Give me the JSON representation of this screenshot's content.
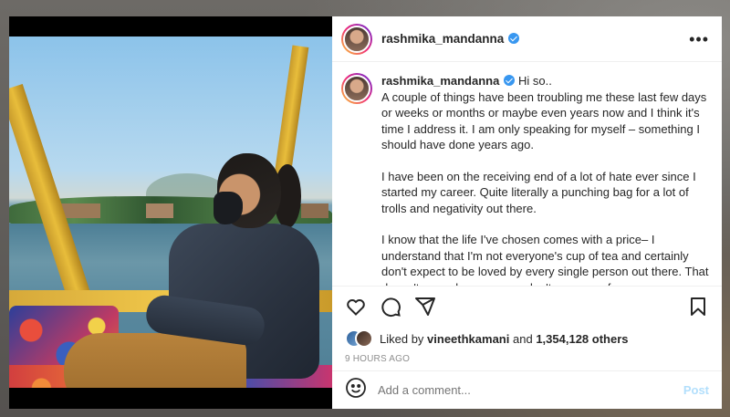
{
  "header": {
    "username": "rashmika_mandanna",
    "more_label": "•••"
  },
  "caption": {
    "username": "rashmika_mandanna",
    "greeting": "Hi so..",
    "paragraphs": [
      "A couple of things have been troubling me these last few days or weeks or months or maybe even years now and I think it's time I address it. I am only speaking for myself – something I should have done years ago.",
      "I have been on the receiving end of a lot of hate ever since I started my career. Quite literally a punching bag for a lot of trolls and negativity out there.",
      "I know that the life I've chosen comes with a price– I understand that I'm not everyone's cup of tea and certainly don't expect to be loved by every single person out there. That doesn't mean because you don't approve of me you can spew negativity"
    ]
  },
  "likes": {
    "prefix": "Liked by",
    "user": "vineethkamani",
    "joiner": "and",
    "count": "1,354,128 others"
  },
  "timestamp": "9 HOURS AGO",
  "comment": {
    "placeholder": "Add a comment...",
    "post_label": "Post"
  },
  "colors": {
    "verified": "#3897f0",
    "post_disabled": "#b2dffc",
    "text": "#262626",
    "muted": "#8e8e8e"
  },
  "icons": [
    "verified-badge-icon",
    "more-options-icon",
    "heart-icon",
    "comment-icon",
    "share-icon",
    "bookmark-icon",
    "emoji-icon"
  ]
}
